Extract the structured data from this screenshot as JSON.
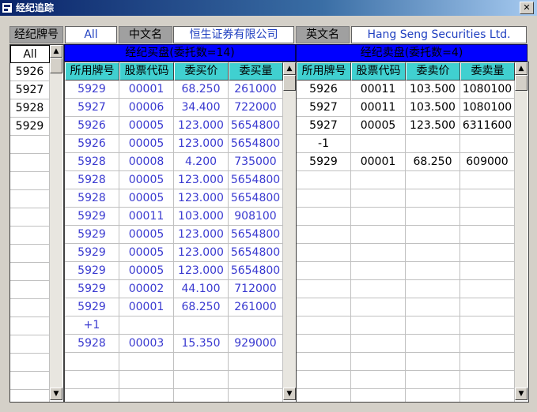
{
  "window": {
    "title": "经纪追踪",
    "close_glyph": "✕"
  },
  "header": {
    "broker_label": "经纪牌号",
    "broker_filter": "All",
    "chinese_name_label": "中文名",
    "chinese_name_value": "恒生证券有限公司",
    "english_name_label": "英文名",
    "english_name_value": "Hang Seng Securities Ltd."
  },
  "brokers": {
    "selected": "All",
    "items": [
      "5926",
      "5927",
      "5928",
      "5929"
    ]
  },
  "buy": {
    "band": "经纪买盘(委托数=14)",
    "columns": [
      "所用牌号",
      "股票代码",
      "委买价",
      "委买量"
    ],
    "rows": [
      [
        "5929",
        "00001",
        "68.250",
        "261000"
      ],
      [
        "5927",
        "00006",
        "34.400",
        "722000"
      ],
      [
        "5926",
        "00005",
        "123.000",
        "5654800"
      ],
      [
        "5926",
        "00005",
        "123.000",
        "5654800"
      ],
      [
        "5928",
        "00008",
        "4.200",
        "735000"
      ],
      [
        "5928",
        "00005",
        "123.000",
        "5654800"
      ],
      [
        "5928",
        "00005",
        "123.000",
        "5654800"
      ],
      [
        "5929",
        "00011",
        "103.000",
        "908100"
      ],
      [
        "5929",
        "00005",
        "123.000",
        "5654800"
      ],
      [
        "5929",
        "00005",
        "123.000",
        "5654800"
      ],
      [
        "5929",
        "00005",
        "123.000",
        "5654800"
      ],
      [
        "5929",
        "00002",
        "44.100",
        "712000"
      ],
      [
        "5929",
        "00001",
        "68.250",
        "261000"
      ],
      [
        "+1",
        "",
        "",
        ""
      ],
      [
        "5928",
        "00003",
        "15.350",
        "929000"
      ]
    ]
  },
  "sell": {
    "band": "经纪卖盘(委托数=4)",
    "columns": [
      "所用牌号",
      "股票代码",
      "委卖价",
      "委卖量"
    ],
    "rows": [
      [
        "5926",
        "00011",
        "103.500",
        "1080100"
      ],
      [
        "5927",
        "00011",
        "103.500",
        "1080100"
      ],
      [
        "5927",
        "00005",
        "123.500",
        "6311600"
      ],
      [
        "-1",
        "",
        "",
        ""
      ],
      [
        "5929",
        "00001",
        "68.250",
        "609000"
      ]
    ]
  },
  "scroll": {
    "up": "▲",
    "down": "▼"
  }
}
